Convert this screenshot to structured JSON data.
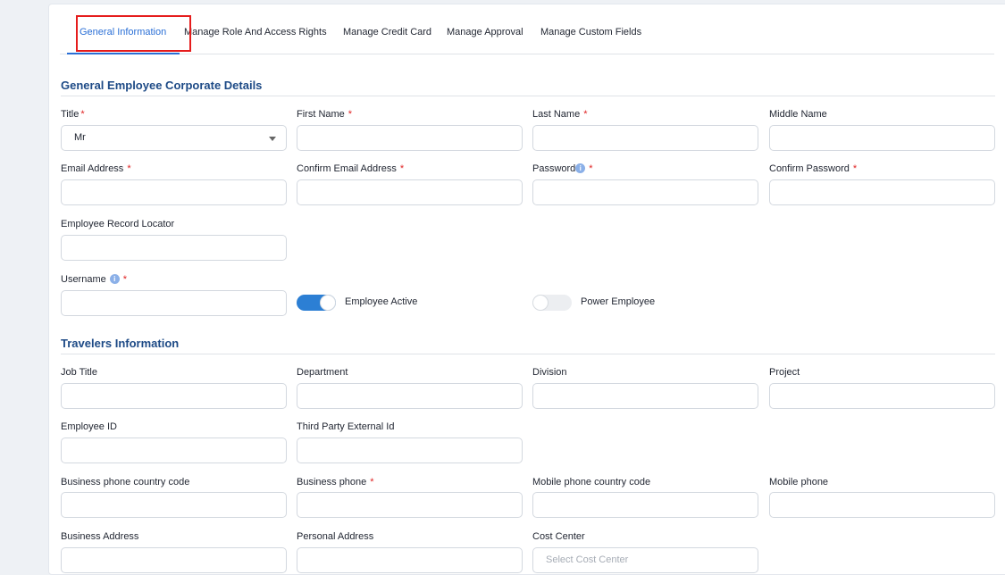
{
  "tabs": [
    {
      "label": "General Information",
      "active": true
    },
    {
      "label": "Manage Role And Access Rights",
      "active": false
    },
    {
      "label": "Manage Credit Card",
      "active": false
    },
    {
      "label": "Manage Approval",
      "active": false
    },
    {
      "label": "Manage Custom Fields",
      "active": false
    }
  ],
  "sections": {
    "corporate": {
      "title": "General Employee Corporate Details"
    },
    "travelers": {
      "title": "Travelers Information"
    }
  },
  "fields": {
    "title": {
      "label": "Title",
      "required": "*",
      "value": "Mr"
    },
    "first_name": {
      "label": "First Name",
      "required": "*",
      "value": ""
    },
    "last_name": {
      "label": "Last Name",
      "required": "*",
      "value": ""
    },
    "middle_name": {
      "label": "Middle Name",
      "value": ""
    },
    "email": {
      "label": "Email Address",
      "required": "*",
      "value": ""
    },
    "confirm_email": {
      "label": "Confirm Email Address",
      "required": "*",
      "value": ""
    },
    "password": {
      "label": "Password",
      "required": "*",
      "value": ""
    },
    "confirm_password": {
      "label": "Confirm Password",
      "required": "*",
      "value": ""
    },
    "record_locator": {
      "label": "Employee Record Locator",
      "value": ""
    },
    "username": {
      "label": "Username",
      "required": "*",
      "value": ""
    },
    "job_title": {
      "label": "Job Title",
      "value": ""
    },
    "department": {
      "label": "Department",
      "value": ""
    },
    "division": {
      "label": "Division",
      "value": ""
    },
    "project": {
      "label": "Project",
      "value": ""
    },
    "employee_id": {
      "label": "Employee ID",
      "value": ""
    },
    "third_party_id": {
      "label": "Third Party External Id",
      "value": ""
    },
    "biz_phone_cc": {
      "label": "Business phone country code",
      "value": ""
    },
    "biz_phone": {
      "label": "Business phone",
      "required": "*",
      "value": ""
    },
    "mobile_cc": {
      "label": "Mobile phone country code",
      "value": ""
    },
    "mobile_phone": {
      "label": "Mobile phone",
      "value": ""
    },
    "biz_address": {
      "label": "Business Address",
      "value": ""
    },
    "personal_address": {
      "label": "Personal Address",
      "value": ""
    },
    "cost_center": {
      "label": "Cost Center",
      "placeholder": "Select Cost Center",
      "value": ""
    }
  },
  "toggles": {
    "employee_active": {
      "label": "Employee Active",
      "on": true
    },
    "power_employee": {
      "label": "Power Employee",
      "on": false
    }
  },
  "colors": {
    "accent": "#2a6fd6",
    "section_title": "#1d4a86",
    "required": "#e02424",
    "highlight_box": "#e51c1c",
    "toggle_on": "#2c7fd4"
  },
  "icons": {
    "info": "info-icon",
    "caret": "chevron-down-icon"
  }
}
